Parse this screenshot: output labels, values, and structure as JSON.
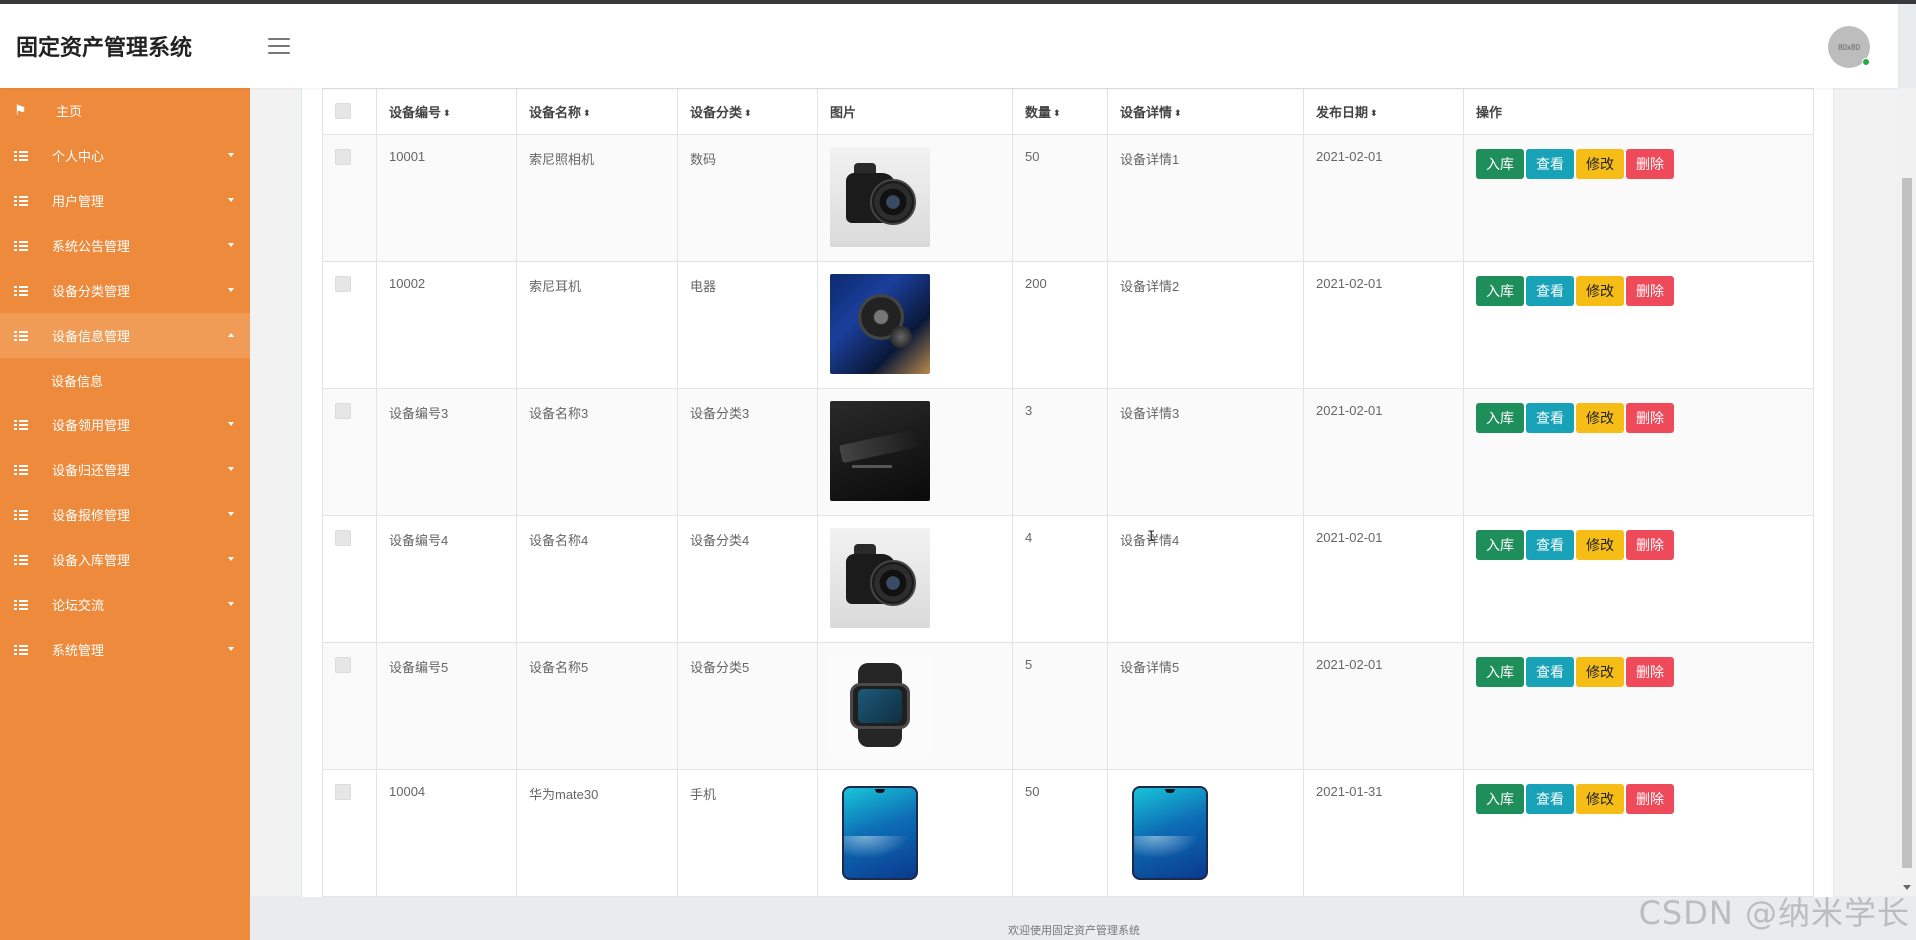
{
  "app": {
    "title": "固定资产管理系统",
    "avatar_text": "80x80"
  },
  "sidebar": {
    "items": [
      {
        "label": "主页",
        "icon": "flag-icon"
      },
      {
        "label": "个人中心",
        "icon": "grid-icon"
      },
      {
        "label": "用户管理",
        "icon": "grid-icon"
      },
      {
        "label": "系统公告管理",
        "icon": "grid-icon"
      },
      {
        "label": "设备分类管理",
        "icon": "grid-icon"
      },
      {
        "label": "设备信息管理",
        "icon": "grid-icon",
        "expanded": true,
        "sub": [
          "设备信息"
        ]
      },
      {
        "label": "设备领用管理",
        "icon": "grid-icon"
      },
      {
        "label": "设备归还管理",
        "icon": "grid-icon"
      },
      {
        "label": "设备报修管理",
        "icon": "grid-icon"
      },
      {
        "label": "设备入库管理",
        "icon": "grid-icon"
      },
      {
        "label": "论坛交流",
        "icon": "grid-icon"
      },
      {
        "label": "系统管理",
        "icon": "grid-icon"
      }
    ]
  },
  "table": {
    "columns": [
      "设备编号",
      "设备名称",
      "设备分类",
      "图片",
      "数量",
      "设备详情",
      "发布日期",
      "操作"
    ],
    "sort_glyph": "⬍",
    "rows": [
      {
        "code": "10001",
        "name": "索尼照相机",
        "category": "数码",
        "image": "camera",
        "qty": "50",
        "detail": "设备详情1",
        "date": "2021-02-01"
      },
      {
        "code": "10002",
        "name": "索尼耳机",
        "category": "电器",
        "image": "earbud",
        "qty": "200",
        "detail": "设备详情2",
        "date": "2021-02-01"
      },
      {
        "code": "设备编号3",
        "name": "设备名称3",
        "category": "设备分类3",
        "image": "dark-device",
        "qty": "3",
        "detail": "设备详情3",
        "date": "2021-02-01"
      },
      {
        "code": "设备编号4",
        "name": "设备名称4",
        "category": "设备分类4",
        "image": "camera",
        "qty": "4",
        "detail": "设备详情4",
        "date": "2021-02-01"
      },
      {
        "code": "设备编号5",
        "name": "设备名称5",
        "category": "设备分类5",
        "image": "watch",
        "qty": "5",
        "detail": "设备详情5",
        "date": "2021-02-01"
      },
      {
        "code": "10004",
        "name": "华为mate30",
        "category": "手机",
        "image": "phone",
        "qty": "50",
        "detail": "",
        "detail_image": "phone",
        "date": "2021-01-31"
      }
    ],
    "actions": {
      "stock_in": "入库",
      "view": "查看",
      "edit": "修改",
      "delete": "删除"
    }
  },
  "footer": {
    "text": "欢迎使用固定资产管理系统"
  },
  "watermark": "CSDN @纳米学长",
  "colors": {
    "sidebar": "#ee8a3c",
    "sidebar_active": "#f19c56",
    "btn_stock_in": "#1e8e5a",
    "btn_view": "#17a2b8",
    "btn_edit": "#f5bd16",
    "btn_delete": "#ef4a5a"
  }
}
